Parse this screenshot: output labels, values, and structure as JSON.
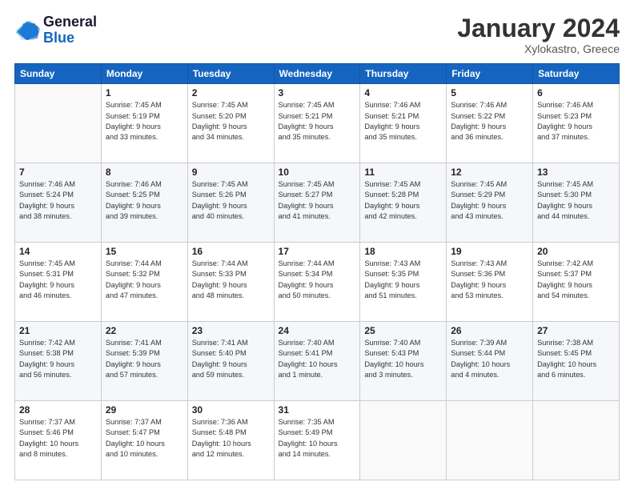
{
  "header": {
    "logo_general": "General",
    "logo_blue": "Blue",
    "title": "January 2024",
    "subtitle": "Xylokastro, Greece"
  },
  "weekdays": [
    "Sunday",
    "Monday",
    "Tuesday",
    "Wednesday",
    "Thursday",
    "Friday",
    "Saturday"
  ],
  "weeks": [
    [
      {
        "day": "",
        "info": ""
      },
      {
        "day": "1",
        "info": "Sunrise: 7:45 AM\nSunset: 5:19 PM\nDaylight: 9 hours\nand 33 minutes."
      },
      {
        "day": "2",
        "info": "Sunrise: 7:45 AM\nSunset: 5:20 PM\nDaylight: 9 hours\nand 34 minutes."
      },
      {
        "day": "3",
        "info": "Sunrise: 7:45 AM\nSunset: 5:21 PM\nDaylight: 9 hours\nand 35 minutes."
      },
      {
        "day": "4",
        "info": "Sunrise: 7:46 AM\nSunset: 5:21 PM\nDaylight: 9 hours\nand 35 minutes."
      },
      {
        "day": "5",
        "info": "Sunrise: 7:46 AM\nSunset: 5:22 PM\nDaylight: 9 hours\nand 36 minutes."
      },
      {
        "day": "6",
        "info": "Sunrise: 7:46 AM\nSunset: 5:23 PM\nDaylight: 9 hours\nand 37 minutes."
      }
    ],
    [
      {
        "day": "7",
        "info": "Sunrise: 7:46 AM\nSunset: 5:24 PM\nDaylight: 9 hours\nand 38 minutes."
      },
      {
        "day": "8",
        "info": "Sunrise: 7:46 AM\nSunset: 5:25 PM\nDaylight: 9 hours\nand 39 minutes."
      },
      {
        "day": "9",
        "info": "Sunrise: 7:45 AM\nSunset: 5:26 PM\nDaylight: 9 hours\nand 40 minutes."
      },
      {
        "day": "10",
        "info": "Sunrise: 7:45 AM\nSunset: 5:27 PM\nDaylight: 9 hours\nand 41 minutes."
      },
      {
        "day": "11",
        "info": "Sunrise: 7:45 AM\nSunset: 5:28 PM\nDaylight: 9 hours\nand 42 minutes."
      },
      {
        "day": "12",
        "info": "Sunrise: 7:45 AM\nSunset: 5:29 PM\nDaylight: 9 hours\nand 43 minutes."
      },
      {
        "day": "13",
        "info": "Sunrise: 7:45 AM\nSunset: 5:30 PM\nDaylight: 9 hours\nand 44 minutes."
      }
    ],
    [
      {
        "day": "14",
        "info": "Sunrise: 7:45 AM\nSunset: 5:31 PM\nDaylight: 9 hours\nand 46 minutes."
      },
      {
        "day": "15",
        "info": "Sunrise: 7:44 AM\nSunset: 5:32 PM\nDaylight: 9 hours\nand 47 minutes."
      },
      {
        "day": "16",
        "info": "Sunrise: 7:44 AM\nSunset: 5:33 PM\nDaylight: 9 hours\nand 48 minutes."
      },
      {
        "day": "17",
        "info": "Sunrise: 7:44 AM\nSunset: 5:34 PM\nDaylight: 9 hours\nand 50 minutes."
      },
      {
        "day": "18",
        "info": "Sunrise: 7:43 AM\nSunset: 5:35 PM\nDaylight: 9 hours\nand 51 minutes."
      },
      {
        "day": "19",
        "info": "Sunrise: 7:43 AM\nSunset: 5:36 PM\nDaylight: 9 hours\nand 53 minutes."
      },
      {
        "day": "20",
        "info": "Sunrise: 7:42 AM\nSunset: 5:37 PM\nDaylight: 9 hours\nand 54 minutes."
      }
    ],
    [
      {
        "day": "21",
        "info": "Sunrise: 7:42 AM\nSunset: 5:38 PM\nDaylight: 9 hours\nand 56 minutes."
      },
      {
        "day": "22",
        "info": "Sunrise: 7:41 AM\nSunset: 5:39 PM\nDaylight: 9 hours\nand 57 minutes."
      },
      {
        "day": "23",
        "info": "Sunrise: 7:41 AM\nSunset: 5:40 PM\nDaylight: 9 hours\nand 59 minutes."
      },
      {
        "day": "24",
        "info": "Sunrise: 7:40 AM\nSunset: 5:41 PM\nDaylight: 10 hours\nand 1 minute."
      },
      {
        "day": "25",
        "info": "Sunrise: 7:40 AM\nSunset: 5:43 PM\nDaylight: 10 hours\nand 3 minutes."
      },
      {
        "day": "26",
        "info": "Sunrise: 7:39 AM\nSunset: 5:44 PM\nDaylight: 10 hours\nand 4 minutes."
      },
      {
        "day": "27",
        "info": "Sunrise: 7:38 AM\nSunset: 5:45 PM\nDaylight: 10 hours\nand 6 minutes."
      }
    ],
    [
      {
        "day": "28",
        "info": "Sunrise: 7:37 AM\nSunset: 5:46 PM\nDaylight: 10 hours\nand 8 minutes."
      },
      {
        "day": "29",
        "info": "Sunrise: 7:37 AM\nSunset: 5:47 PM\nDaylight: 10 hours\nand 10 minutes."
      },
      {
        "day": "30",
        "info": "Sunrise: 7:36 AM\nSunset: 5:48 PM\nDaylight: 10 hours\nand 12 minutes."
      },
      {
        "day": "31",
        "info": "Sunrise: 7:35 AM\nSunset: 5:49 PM\nDaylight: 10 hours\nand 14 minutes."
      },
      {
        "day": "",
        "info": ""
      },
      {
        "day": "",
        "info": ""
      },
      {
        "day": "",
        "info": ""
      }
    ]
  ]
}
